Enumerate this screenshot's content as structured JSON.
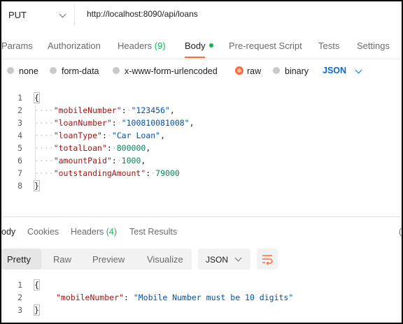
{
  "request": {
    "method": "PUT",
    "url": "http://localhost:8090/api/loans"
  },
  "request_tabs": [
    "Params",
    "Authorization",
    "Headers",
    "(9)",
    "Body",
    "Pre-request Script",
    "Tests",
    "Settings"
  ],
  "body_types": {
    "none": "none",
    "form_data": "form-data",
    "urlencoded": "x-www-form-urlencoded",
    "raw": "raw",
    "binary": "binary",
    "language": "JSON"
  },
  "request_body": {
    "line_numbers": [
      "1",
      "2",
      "3",
      "4",
      "5",
      "6",
      "7",
      "8"
    ],
    "open": "{",
    "close": "}",
    "fields": [
      {
        "key": "\"mobileNumber\"",
        "value": "\"123456\"",
        "kind": "string",
        "comma": ","
      },
      {
        "key": "\"loanNumber\"",
        "value": "\"100810081008\"",
        "kind": "string",
        "comma": ","
      },
      {
        "key": "\"loanType\"",
        "value": "\"Car Loan\"",
        "kind": "string",
        "comma": ","
      },
      {
        "key": "\"totalLoan\"",
        "value": "800000",
        "kind": "number",
        "comma": ","
      },
      {
        "key": "\"amountPaid\"",
        "value": "1000",
        "kind": "number",
        "comma": ","
      },
      {
        "key": "\"outstandingAmount\"",
        "value": "79000",
        "kind": "number",
        "comma": ""
      }
    ]
  },
  "response_tabs": {
    "body": "ody",
    "cookies": "Cookies",
    "headers": "Headers",
    "headers_count": "(4)",
    "test_results": "Test Results",
    "clipped": "("
  },
  "response_formats": {
    "pretty": "Pretty",
    "raw": "Raw",
    "preview": "Preview",
    "visualize": "Visualize",
    "language": "JSON"
  },
  "response_body": {
    "line_numbers": [
      "1",
      "2",
      "3"
    ],
    "open": "{",
    "close": "}",
    "key": "\"mobileNumber\"",
    "value": "\"Mobile Number must be 10 digits\""
  }
}
